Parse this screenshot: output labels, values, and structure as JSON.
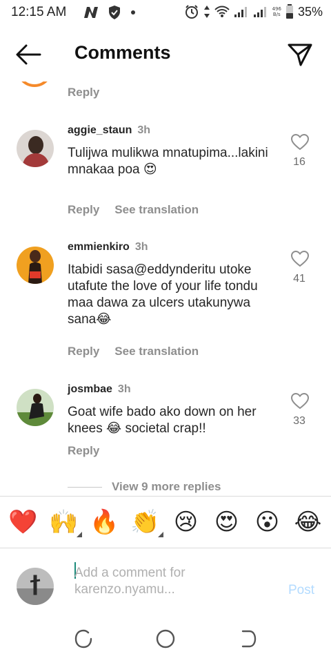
{
  "status_bar": {
    "time": "12:15 AM",
    "net_speed_value": "496",
    "net_speed_unit": "B/s",
    "battery": "35%"
  },
  "header": {
    "title": "Comments",
    "back_icon": "arrow-left-icon",
    "send_icon": "paper-plane-icon"
  },
  "comments": {
    "top_reply_label": "Reply",
    "items": [
      {
        "username": "aggie_staun",
        "time": "3h",
        "text": "Tulijwa mulikwa mnatupima...lakini mnakaa poa 😍",
        "likes": "16",
        "reply_label": "Reply",
        "translate_label": "See translation"
      },
      {
        "username": "emmienkiro",
        "time": "3h",
        "text": "Itabidi sasa@eddynderitu utoke utafute the love of your life tondu maa dawa za ulcers utakunywa sana😂",
        "likes": "41",
        "reply_label": "Reply",
        "translate_label": "See translation"
      },
      {
        "username": "josmbae",
        "time": "3h",
        "text": "Goat wife bado ako down on her knees 😂 societal crap!!",
        "likes": "33",
        "reply_label": "Reply"
      }
    ],
    "view_more": "View 9 more replies"
  },
  "emoji_bar": [
    "❤️",
    "🙌",
    "🔥",
    "👏",
    "😢",
    "😍",
    "😮",
    "😂"
  ],
  "composer": {
    "placeholder": "Add a comment for karenzo.nyamu...",
    "post_label": "Post"
  },
  "colors": {
    "accent_link": "#b3dbff",
    "muted_text": "#8e8e8e"
  }
}
